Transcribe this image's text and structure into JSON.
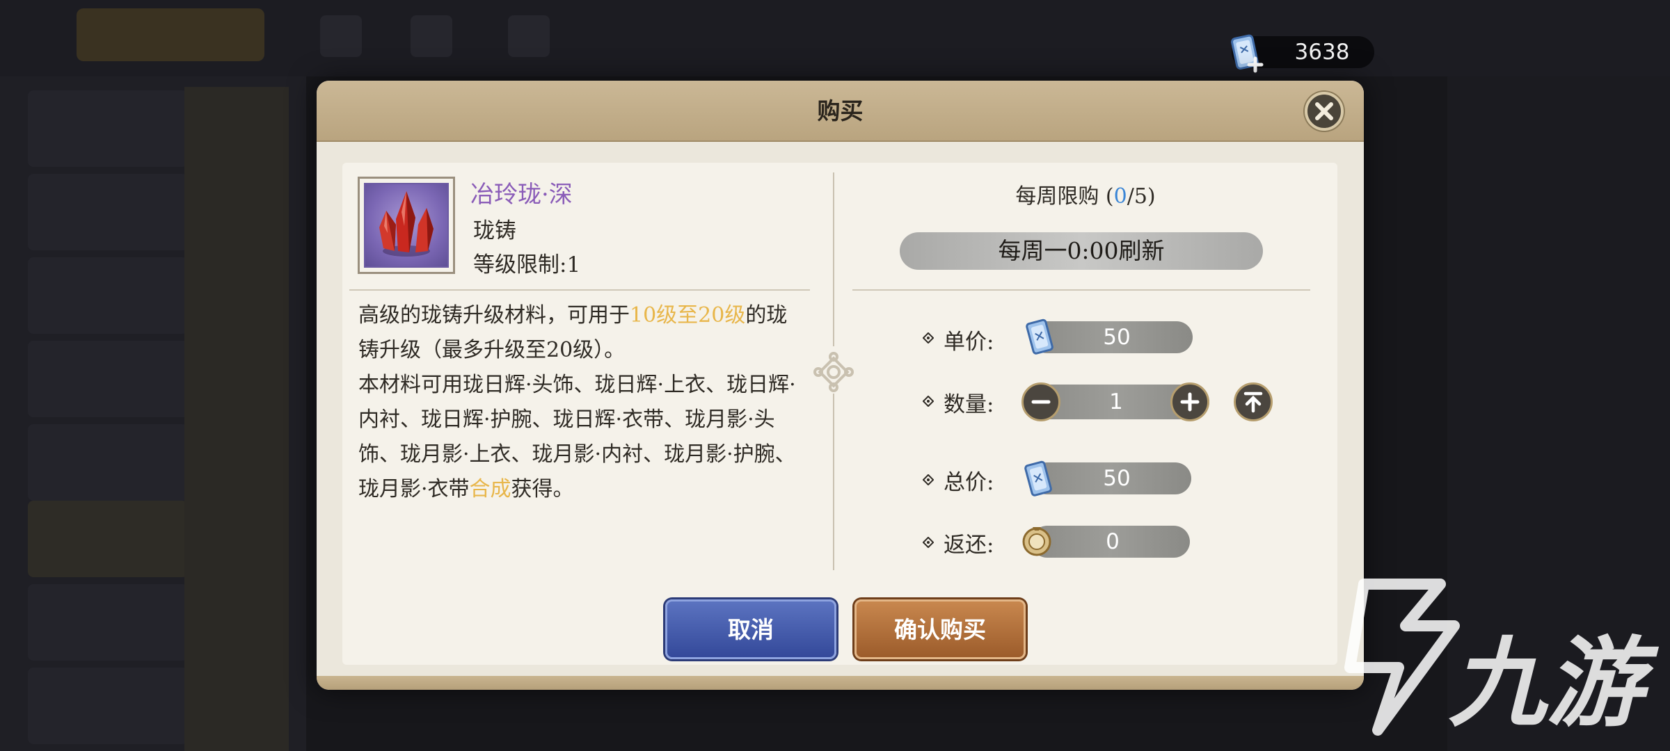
{
  "currency": {
    "icon": "ticket-plus-icon",
    "value": "3638"
  },
  "dialog": {
    "title": "购买",
    "close_icon": "close-icon"
  },
  "item": {
    "name": "冶玲珑·深",
    "type": "珑铸",
    "level_limit": "等级限制:1",
    "icon": "red-crystal-icon",
    "description": [
      {
        "text": "高级的珑铸升级材料，可用于",
        "highlight": false
      },
      {
        "text": "10级至20级",
        "highlight": true
      },
      {
        "text": "的珑铸升级（最多升级至20级）。",
        "highlight": false
      },
      {
        "text": "本材料可用珑日辉·头饰、珑日辉·上衣、珑日辉·内衬、珑日辉·护腕、珑日辉·衣带、珑月影·头饰、珑月影·上衣、珑月影·内衬、珑月影·护腕、珑月影·衣带",
        "highlight": false
      },
      {
        "text": "合成",
        "highlight": true
      },
      {
        "text": "获得。",
        "highlight": false
      }
    ]
  },
  "purchase": {
    "weekly_limit_prefix": "每周限购 (",
    "weekly_limit_current": "0",
    "weekly_limit_sep": "/",
    "weekly_limit_max": "5",
    "weekly_limit_suffix": ")",
    "refresh_text": "每周一0:00刷新",
    "unit_price_label": "单价:",
    "unit_price": "50",
    "quantity_label": "数量:",
    "quantity": "1",
    "total_price_label": "总价:",
    "total_price": "50",
    "refund_label": "返还:",
    "refund": "0"
  },
  "buttons": {
    "cancel": "取消",
    "confirm": "确认购买"
  },
  "watermark": {
    "text": "九游"
  },
  "colors": {
    "highlight": "#e8b64a",
    "item_name": "#8a5cb8",
    "limit_current": "#3b86d6",
    "cancel_button": "#34499a",
    "confirm_button": "#9c5c2b"
  }
}
